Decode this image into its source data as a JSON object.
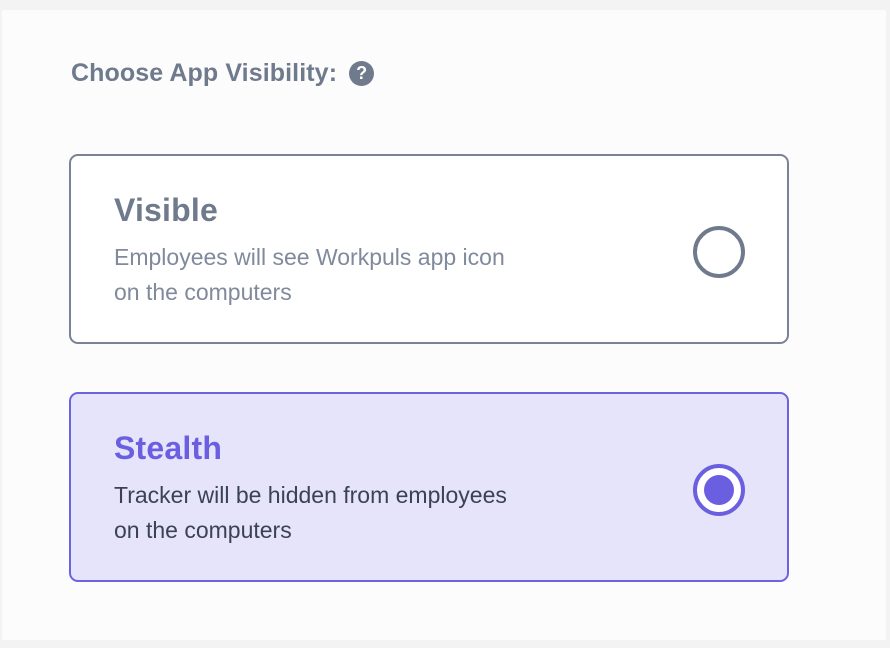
{
  "header": {
    "title": "Choose App Visibility:",
    "help_icon": "question-circle-icon"
  },
  "options": [
    {
      "title": "Visible",
      "description_line1": "Employees will see Workpuls app icon",
      "description_line2": "on the computers",
      "selected": false
    },
    {
      "title": "Stealth",
      "description_line1": "Tracker will be hidden from employees",
      "description_line2": "on the computers",
      "selected": true
    }
  ],
  "colors": {
    "accent": "#6a5fe0",
    "selected_background": "#e6e4fb",
    "muted_text": "#6f7a8c",
    "border_default": "#7a8396"
  }
}
